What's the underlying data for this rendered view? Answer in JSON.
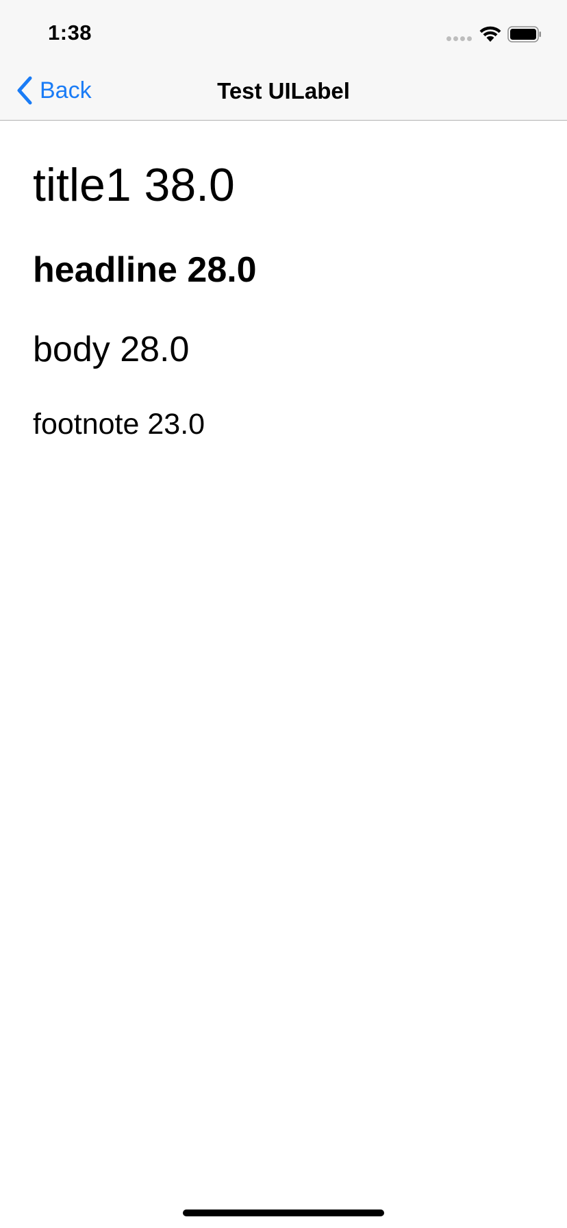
{
  "status_bar": {
    "time": "1:38",
    "icons": [
      "signal-dots-icon",
      "wifi-icon",
      "battery-icon"
    ]
  },
  "nav": {
    "back_label": "Back",
    "title": "Test UILabel",
    "accent_color": "#1a7cf6"
  },
  "labels": {
    "title1": "title1 38.0",
    "headline": "headline 28.0",
    "body": "body 28.0",
    "footnote": "footnote 23.0"
  }
}
